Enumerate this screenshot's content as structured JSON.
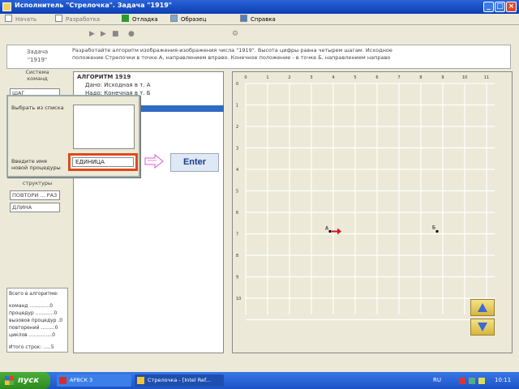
{
  "window": {
    "title": "Исполнитель \"Стрелочка\". Задача \"1919\""
  },
  "menu": {
    "items": [
      {
        "label": "Начать",
        "enabled": false
      },
      {
        "label": "Разработка",
        "enabled": false
      },
      {
        "label": "Отладка",
        "enabled": true
      },
      {
        "label": "Образец",
        "enabled": true
      },
      {
        "label": "Справка",
        "enabled": true
      }
    ]
  },
  "task": {
    "label_line1": "Задача",
    "label_line2": "\"1919\"",
    "description_line1": "Разработайте алгоритм изображения-изображения числа \"1919\". Высота цифры равна четырем шагам. Исходное",
    "description_line2": "положение Стрелочки в точке А, направлением вправо. Конечное положение - в точке Б, направлением направо"
  },
  "left": {
    "caption1": "Система",
    "caption2": "команд",
    "btn1": "ШАГ",
    "structures": "структуры",
    "btn2": "ПОВТОРИ ... РАЗ",
    "btn3": "ДЛИНА"
  },
  "stats": {
    "title": "Всего в алгоритме:",
    "lines": [
      "команд .............0",
      "процедур ............0",
      "вызовов процедур .0",
      "повторений .........0",
      "циклов ...............0"
    ],
    "footer": "Итого строк: .....5"
  },
  "algorithm": {
    "lines": [
      "АЛГОРИТМ 1919",
      "Дано: Исходная в т. А",
      "Надо: Конечная в т. Б"
    ]
  },
  "popup": {
    "choose_label": "Выбрать из списка",
    "enter_label1": "Введите имя",
    "enter_label2": "новой процедуры",
    "input_value": "ЕДИНИЦА"
  },
  "enter_button": "Enter",
  "grid": {
    "x_ticks": [
      "0",
      "1",
      "2",
      "3",
      "4",
      "5",
      "6",
      "7",
      "8",
      "9",
      "10",
      "11"
    ],
    "y_ticks": [
      "0",
      "1",
      "2",
      "3",
      "4",
      "5",
      "6",
      "7",
      "8",
      "9",
      "10"
    ],
    "point_a": "А",
    "point_b": "Б"
  },
  "taskbar": {
    "start": "пуск",
    "task1": "АРВСК 3",
    "task2": "Стрелочка - [Intel Ref...",
    "lang": "RU",
    "time": "10:11"
  },
  "colors": {
    "accent": "#e04818",
    "title_blue": "#0b3fb3",
    "arrow": "#d81818"
  }
}
